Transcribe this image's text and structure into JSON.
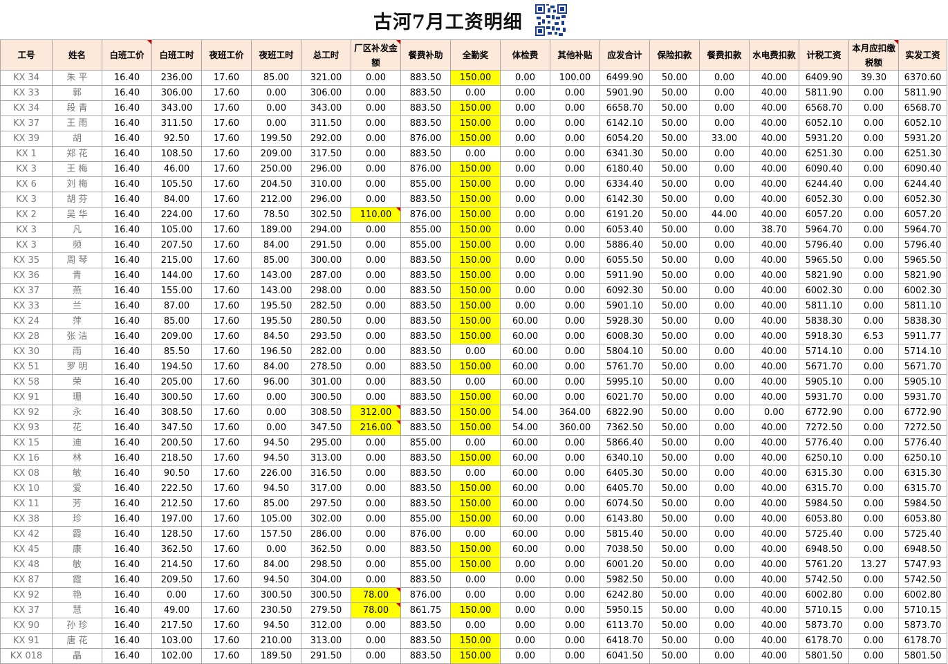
{
  "title": "古河7月工资明细",
  "columns": [
    "工号",
    "姓名",
    "白班工价",
    "白班工时",
    "夜班工价",
    "夜班工时",
    "总工时",
    "厂区补发金额",
    "餐费补助",
    "全勤奖",
    "体检费",
    "其他补贴",
    "应发合计",
    "保险扣款",
    "餐费扣款",
    "水电费扣款",
    "计税工资",
    "本月应扣缴税额",
    "实发工资"
  ],
  "highlight_color": "#ffff00",
  "header_color": "#fde9d9",
  "rows": [
    [
      "KX   34",
      "朱   平",
      "16.40",
      "236.00",
      "17.60",
      "85.00",
      "321.00",
      "0.00",
      "883.50",
      "150.00",
      "0.00",
      "100.00",
      "6499.90",
      "50.00",
      "0.00",
      "40.00",
      "6409.90",
      "39.30",
      "6370.60"
    ],
    [
      "KX   33",
      "郭",
      "16.40",
      "306.00",
      "17.60",
      "0.00",
      "306.00",
      "0.00",
      "883.50",
      "0.00",
      "0.00",
      "0.00",
      "5901.90",
      "50.00",
      "0.00",
      "40.00",
      "5811.90",
      "0.00",
      "5811.90"
    ],
    [
      "KX   34",
      "段   青",
      "16.40",
      "343.00",
      "17.60",
      "0.00",
      "343.00",
      "0.00",
      "883.50",
      "150.00",
      "0.00",
      "0.00",
      "6658.70",
      "50.00",
      "0.00",
      "40.00",
      "6568.70",
      "0.00",
      "6568.70"
    ],
    [
      "KX   37",
      "王   雨",
      "16.40",
      "311.50",
      "17.60",
      "0.00",
      "311.50",
      "0.00",
      "883.50",
      "150.00",
      "0.00",
      "0.00",
      "6142.10",
      "50.00",
      "0.00",
      "40.00",
      "6052.10",
      "0.00",
      "6052.10"
    ],
    [
      "KX   39",
      "胡",
      "16.40",
      "92.50",
      "17.60",
      "199.50",
      "292.00",
      "0.00",
      "876.00",
      "150.00",
      "0.00",
      "0.00",
      "6054.20",
      "50.00",
      "33.00",
      "40.00",
      "5931.20",
      "0.00",
      "5931.20"
    ],
    [
      "KX   1",
      "郑   花",
      "16.40",
      "108.50",
      "17.60",
      "209.00",
      "317.50",
      "0.00",
      "883.50",
      "0.00",
      "0.00",
      "0.00",
      "6341.30",
      "50.00",
      "0.00",
      "40.00",
      "6251.30",
      "0.00",
      "6251.30"
    ],
    [
      "KX   3",
      "王   梅",
      "16.40",
      "46.00",
      "17.60",
      "250.00",
      "296.00",
      "0.00",
      "876.00",
      "150.00",
      "0.00",
      "0.00",
      "6180.40",
      "50.00",
      "0.00",
      "40.00",
      "6090.40",
      "0.00",
      "6090.40"
    ],
    [
      "KX   6",
      "刘   梅",
      "16.40",
      "105.50",
      "17.60",
      "204.50",
      "310.00",
      "0.00",
      "855.00",
      "150.00",
      "0.00",
      "0.00",
      "6334.40",
      "50.00",
      "0.00",
      "40.00",
      "6244.40",
      "0.00",
      "6244.40"
    ],
    [
      "KX   3",
      "胡   芬",
      "16.40",
      "84.00",
      "17.60",
      "212.00",
      "296.00",
      "0.00",
      "883.50",
      "150.00",
      "0.00",
      "0.00",
      "6142.30",
      "50.00",
      "0.00",
      "40.00",
      "6052.30",
      "0.00",
      "6052.30"
    ],
    [
      "KX   2",
      "吴   华",
      "16.40",
      "224.00",
      "17.60",
      "78.50",
      "302.50",
      "110.00",
      "876.00",
      "150.00",
      "0.00",
      "0.00",
      "6191.20",
      "50.00",
      "44.00",
      "40.00",
      "6057.20",
      "0.00",
      "6057.20"
    ],
    [
      "KX   3",
      "   凡",
      "16.40",
      "105.00",
      "17.60",
      "189.00",
      "294.00",
      "0.00",
      "855.00",
      "150.00",
      "0.00",
      "0.00",
      "6053.40",
      "50.00",
      "0.00",
      "38.70",
      "5964.70",
      "0.00",
      "5964.70"
    ],
    [
      "KX   3",
      "   频",
      "16.40",
      "207.50",
      "17.60",
      "84.00",
      "291.50",
      "0.00",
      "855.00",
      "150.00",
      "0.00",
      "0.00",
      "5886.40",
      "50.00",
      "0.00",
      "40.00",
      "5796.40",
      "0.00",
      "5796.40"
    ],
    [
      "KX   35",
      "周   琴",
      "16.40",
      "215.00",
      "17.60",
      "85.00",
      "300.00",
      "0.00",
      "883.50",
      "150.00",
      "0.00",
      "0.00",
      "6055.50",
      "50.00",
      "0.00",
      "40.00",
      "5965.50",
      "0.00",
      "5965.50"
    ],
    [
      "KX   36",
      "   青",
      "16.40",
      "144.00",
      "17.60",
      "143.00",
      "287.00",
      "0.00",
      "883.50",
      "150.00",
      "0.00",
      "0.00",
      "5911.90",
      "50.00",
      "0.00",
      "40.00",
      "5821.90",
      "0.00",
      "5821.90"
    ],
    [
      "KX   37",
      "   燕",
      "16.40",
      "155.00",
      "17.60",
      "143.00",
      "298.00",
      "0.00",
      "883.50",
      "150.00",
      "0.00",
      "0.00",
      "6092.30",
      "50.00",
      "0.00",
      "40.00",
      "6002.30",
      "0.00",
      "6002.30"
    ],
    [
      "KX   33",
      "   兰",
      "16.40",
      "87.00",
      "17.60",
      "195.50",
      "282.50",
      "0.00",
      "883.50",
      "150.00",
      "0.00",
      "0.00",
      "5901.10",
      "50.00",
      "0.00",
      "40.00",
      "5811.10",
      "0.00",
      "5811.10"
    ],
    [
      "KX   24",
      "   萍",
      "16.40",
      "85.00",
      "17.60",
      "195.50",
      "280.50",
      "0.00",
      "883.50",
      "150.00",
      "60.00",
      "0.00",
      "5928.30",
      "50.00",
      "0.00",
      "40.00",
      "5838.30",
      "0.00",
      "5838.30"
    ],
    [
      "KX   28",
      "张   洁",
      "16.40",
      "209.00",
      "17.60",
      "84.50",
      "293.50",
      "0.00",
      "883.50",
      "150.00",
      "60.00",
      "0.00",
      "6008.30",
      "50.00",
      "0.00",
      "40.00",
      "5918.30",
      "6.53",
      "5911.77"
    ],
    [
      "KX   30",
      "   雨",
      "16.40",
      "85.50",
      "17.60",
      "196.50",
      "282.00",
      "0.00",
      "883.50",
      "0.00",
      "60.00",
      "0.00",
      "5804.10",
      "50.00",
      "0.00",
      "40.00",
      "5714.10",
      "0.00",
      "5714.10"
    ],
    [
      "KX   51",
      "罗   明",
      "16.40",
      "194.50",
      "17.60",
      "84.00",
      "278.50",
      "0.00",
      "883.50",
      "150.00",
      "60.00",
      "0.00",
      "5761.70",
      "50.00",
      "0.00",
      "40.00",
      "5671.70",
      "0.00",
      "5671.70"
    ],
    [
      "KX   58",
      "   荣",
      "16.40",
      "205.00",
      "17.60",
      "96.00",
      "301.00",
      "0.00",
      "883.50",
      "0.00",
      "60.00",
      "0.00",
      "5995.10",
      "50.00",
      "0.00",
      "40.00",
      "5905.10",
      "0.00",
      "5905.10"
    ],
    [
      "KX   91",
      "   珊",
      "16.40",
      "300.50",
      "17.60",
      "0.00",
      "300.50",
      "0.00",
      "883.50",
      "150.00",
      "60.00",
      "0.00",
      "6021.70",
      "50.00",
      "0.00",
      "40.00",
      "5931.70",
      "0.00",
      "5931.70"
    ],
    [
      "KX   92",
      "   永",
      "16.40",
      "308.50",
      "17.60",
      "0.00",
      "308.50",
      "312.00",
      "883.50",
      "150.00",
      "54.00",
      "364.00",
      "6822.90",
      "50.00",
      "0.00",
      "0.00",
      "6772.90",
      "0.00",
      "6772.90"
    ],
    [
      "KX   93",
      "   花",
      "16.40",
      "347.50",
      "17.60",
      "0.00",
      "347.50",
      "216.00",
      "883.50",
      "150.00",
      "54.00",
      "360.00",
      "7362.50",
      "50.00",
      "0.00",
      "40.00",
      "7272.50",
      "0.00",
      "7272.50"
    ],
    [
      "KX   15",
      "   迪",
      "16.40",
      "200.50",
      "17.60",
      "94.50",
      "295.00",
      "0.00",
      "855.00",
      "0.00",
      "60.00",
      "0.00",
      "5866.40",
      "50.00",
      "0.00",
      "40.00",
      "5776.40",
      "0.00",
      "5776.40"
    ],
    [
      "KX   16",
      "   林",
      "16.40",
      "218.50",
      "17.60",
      "94.50",
      "313.00",
      "0.00",
      "883.50",
      "150.00",
      "60.00",
      "0.00",
      "6340.10",
      "50.00",
      "0.00",
      "40.00",
      "6250.10",
      "0.00",
      "6250.10"
    ],
    [
      "KX   08",
      "   敏",
      "16.40",
      "90.50",
      "17.60",
      "226.00",
      "316.50",
      "0.00",
      "883.50",
      "0.00",
      "60.00",
      "0.00",
      "6405.30",
      "50.00",
      "0.00",
      "40.00",
      "6315.30",
      "0.00",
      "6315.30"
    ],
    [
      "KX   10",
      "   爱",
      "16.40",
      "222.50",
      "17.60",
      "94.50",
      "317.00",
      "0.00",
      "883.50",
      "150.00",
      "60.00",
      "0.00",
      "6405.70",
      "50.00",
      "0.00",
      "40.00",
      "6315.70",
      "0.00",
      "6315.70"
    ],
    [
      "KX   11",
      "   芳",
      "16.40",
      "212.50",
      "17.60",
      "85.00",
      "297.50",
      "0.00",
      "883.50",
      "150.00",
      "60.00",
      "0.00",
      "6074.50",
      "50.00",
      "0.00",
      "40.00",
      "5984.50",
      "0.00",
      "5984.50"
    ],
    [
      "KX   38",
      "   珍",
      "16.40",
      "197.00",
      "17.60",
      "105.00",
      "302.00",
      "0.00",
      "855.00",
      "150.00",
      "60.00",
      "0.00",
      "6143.80",
      "50.00",
      "0.00",
      "40.00",
      "6053.80",
      "0.00",
      "6053.80"
    ],
    [
      "KX   42",
      "   霞",
      "16.40",
      "128.50",
      "17.60",
      "157.50",
      "286.00",
      "0.00",
      "876.00",
      "0.00",
      "60.00",
      "0.00",
      "5815.40",
      "50.00",
      "0.00",
      "40.00",
      "5725.40",
      "0.00",
      "5725.40"
    ],
    [
      "KX   45",
      "   康",
      "16.40",
      "362.50",
      "17.60",
      "0.00",
      "362.50",
      "0.00",
      "883.50",
      "150.00",
      "60.00",
      "0.00",
      "7038.50",
      "50.00",
      "0.00",
      "40.00",
      "6948.50",
      "0.00",
      "6948.50"
    ],
    [
      "KX   48",
      "   敏",
      "16.40",
      "214.50",
      "17.60",
      "84.00",
      "298.50",
      "0.00",
      "855.00",
      "150.00",
      "0.00",
      "0.00",
      "6001.20",
      "50.00",
      "0.00",
      "40.00",
      "5761.20",
      "13.27",
      "5747.93"
    ],
    [
      "KX   87",
      "   霞",
      "16.40",
      "209.50",
      "17.60",
      "94.50",
      "304.00",
      "0.00",
      "883.50",
      "0.00",
      "0.00",
      "0.00",
      "5982.50",
      "50.00",
      "0.00",
      "40.00",
      "5742.50",
      "0.00",
      "5742.50"
    ],
    [
      "KX   92",
      "   艳",
      "16.40",
      "0.00",
      "17.60",
      "300.50",
      "300.50",
      "78.00",
      "876.00",
      "0.00",
      "0.00",
      "0.00",
      "6242.80",
      "50.00",
      "0.00",
      "40.00",
      "6002.80",
      "0.00",
      "6002.80"
    ],
    [
      "KX   37",
      "   慧",
      "16.40",
      "49.00",
      "17.60",
      "230.50",
      "279.50",
      "78.00",
      "861.75",
      "150.00",
      "0.00",
      "0.00",
      "5950.15",
      "50.00",
      "0.00",
      "40.00",
      "5710.15",
      "0.00",
      "5710.15"
    ],
    [
      "KX   90",
      "孙   珍",
      "16.40",
      "217.50",
      "17.60",
      "94.50",
      "312.00",
      "0.00",
      "883.50",
      "0.00",
      "0.00",
      "0.00",
      "6113.70",
      "50.00",
      "0.00",
      "40.00",
      "5873.70",
      "0.00",
      "5873.70"
    ],
    [
      "KX   91",
      "唐   花",
      "16.40",
      "103.00",
      "17.60",
      "210.00",
      "313.00",
      "0.00",
      "883.50",
      "150.00",
      "0.00",
      "0.00",
      "6418.70",
      "50.00",
      "0.00",
      "40.00",
      "6178.70",
      "0.00",
      "6178.70"
    ],
    [
      "KX   018",
      "   晶",
      "16.40",
      "102.00",
      "17.60",
      "189.50",
      "291.50",
      "0.00",
      "883.50",
      "150.00",
      "0.00",
      "0.00",
      "6041.50",
      "50.00",
      "0.00",
      "40.00",
      "5801.50",
      "0.00",
      "5801.50"
    ]
  ]
}
